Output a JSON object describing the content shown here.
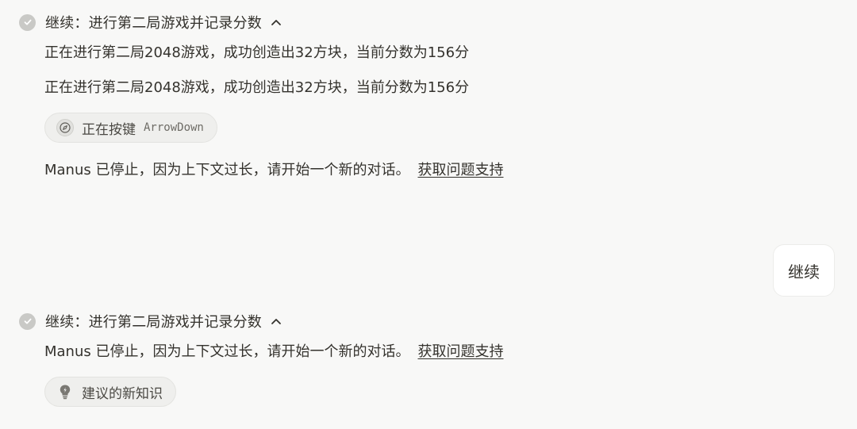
{
  "steps": [
    {
      "title": "继续：进行第二局游戏并记录分数",
      "lines": [
        "正在进行第二局2048游戏，成功创造出32方块，当前分数为156分",
        "正在进行第二局2048游戏，成功创造出32方块，当前分数为156分"
      ],
      "tool": {
        "label": "正在按键",
        "code": "ArrowDown",
        "icon": "compass-icon"
      },
      "stop_message": "Manus 已停止，因为上下文过长，请开始一个新的对话。",
      "support_link": "获取问题支持"
    },
    {
      "title": "继续：进行第二局游戏并记录分数",
      "stop_message": "Manus 已停止，因为上下文过长，请开始一个新的对话。",
      "support_link": "获取问题支持",
      "suggestion": {
        "label": "建议的新知识",
        "icon": "lightbulb-icon"
      }
    }
  ],
  "user_message": "继续",
  "colors": {
    "background": "#f8f8f7",
    "text": "#34322d",
    "check_badge": "#c9c9c6",
    "chip_bg": "#efefed",
    "bubble_bg": "#ffffff"
  }
}
